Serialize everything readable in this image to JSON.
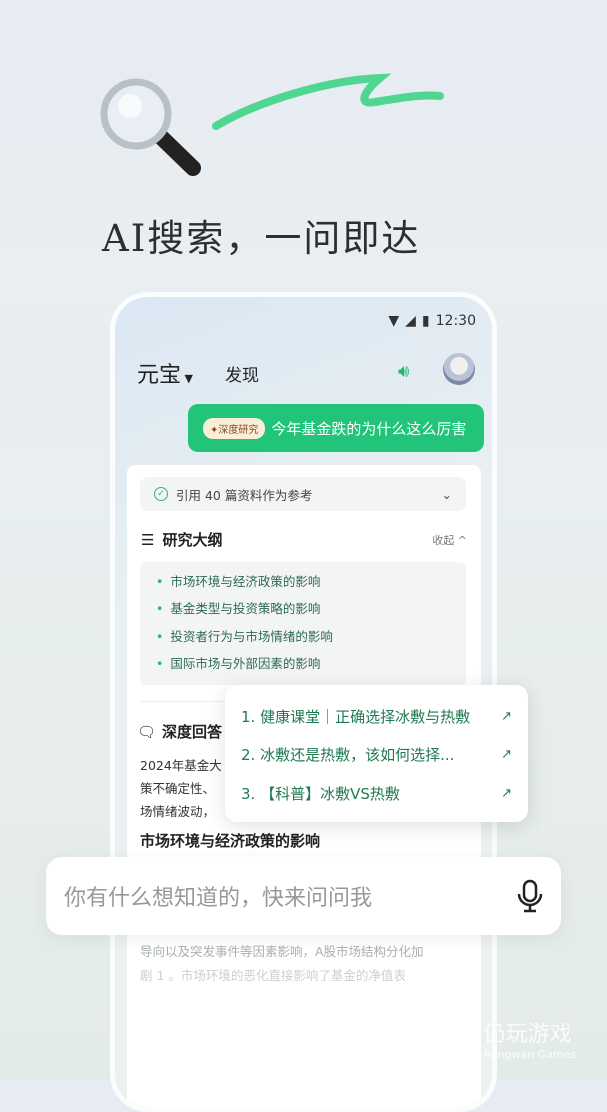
{
  "headline": "AI搜索，一问即达",
  "status": {
    "time": "12:30"
  },
  "header": {
    "brand": "元宝",
    "discover": "发现"
  },
  "bubble": {
    "badge": "✦深度研究",
    "text": "今年基金跌的为什么这么厉害"
  },
  "citations": "引用 40 篇资料作为参考",
  "outline": {
    "title": "研究大纲",
    "collapse": "收起",
    "items": [
      "市场环境与经济政策的影响",
      "基金类型与投资策略的影响",
      "投资者行为与市场情绪的影响",
      "国际市场与外部因素的影响"
    ]
  },
  "answer": {
    "title": "深度回答",
    "lines": [
      "2024年基金大",
      "策不确定性、",
      "场情绪波动，"
    ],
    "heading": "市场环境与经济政策的影响",
    "faded": [
      "导向以及突发事件等因素影响，A股市场结构分化加",
      "剧 1 。市场环境的恶化直接影响了基金的净值表"
    ]
  },
  "popup": {
    "items": [
      "1. 健康课堂｜正确选择冰敷与热敷",
      "2. 冰敷还是热敷，该如何选择...",
      "3. 【科普】冰敷VS热敷"
    ]
  },
  "input": {
    "placeholder": "你有什么想知道的，快来问问我"
  },
  "watermark": {
    "cn": "仍玩游戏",
    "en": "Rengwan Games"
  },
  "colors": {
    "accent": "#22c47a",
    "link": "#1f7a52"
  }
}
